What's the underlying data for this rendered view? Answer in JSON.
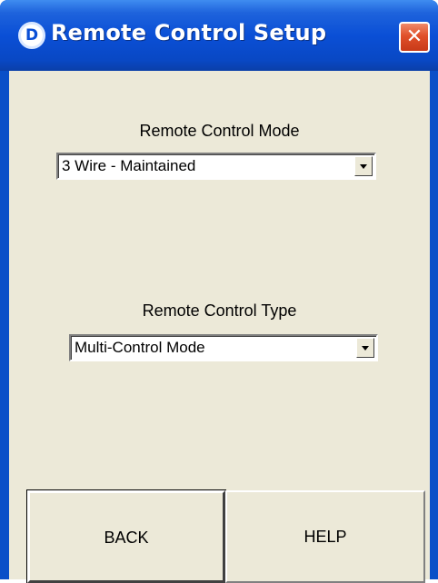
{
  "window": {
    "title": "Remote Control Setup",
    "icon_glyph": "D",
    "close_glyph": "✕"
  },
  "mode": {
    "label": "Remote Control Mode",
    "value": "3 Wire - Maintained"
  },
  "type": {
    "label": "Remote Control Type",
    "value": "Multi-Control Mode"
  },
  "buttons": {
    "back": "BACK",
    "help": "HELP"
  },
  "colors": {
    "titlebar": "#0a4fd6",
    "close": "#e0502a",
    "client_bg": "#ece9d8"
  }
}
